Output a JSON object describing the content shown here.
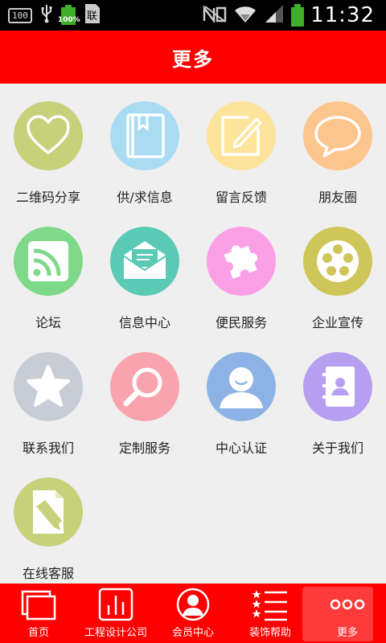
{
  "status_bar": {
    "badge": "100",
    "battery_small_pct": "100%",
    "time": "11:32"
  },
  "header": {
    "title": "更多"
  },
  "grid": {
    "items": [
      {
        "label": "二维码分享",
        "icon": "heart-icon",
        "color": "#c7d17a"
      },
      {
        "label": "供/求信息",
        "icon": "book-icon",
        "color": "#a9dcf3"
      },
      {
        "label": "留言反馈",
        "icon": "note-pencil-icon",
        "color": "#fde49b"
      },
      {
        "label": "朋友圈",
        "icon": "speech-bubble-icon",
        "color": "#fdc58e"
      },
      {
        "label": "论坛",
        "icon": "rss-icon",
        "color": "#7fd98a"
      },
      {
        "label": "信息中心",
        "icon": "envelope-icon",
        "color": "#5bcab5"
      },
      {
        "label": "便民服务",
        "icon": "puzzle-icon",
        "color": "#fba0e6"
      },
      {
        "label": "企业宣传",
        "icon": "film-reel-icon",
        "color": "#cfc65a"
      },
      {
        "label": "联系我们",
        "icon": "star-icon",
        "color": "#c7ccd6"
      },
      {
        "label": "定制服务",
        "icon": "magnifier-icon",
        "color": "#f8a3ad"
      },
      {
        "label": "中心认证",
        "icon": "user-icon",
        "color": "#8db3e6"
      },
      {
        "label": "关于我们",
        "icon": "contact-book-icon",
        "color": "#b69ff0"
      },
      {
        "label": "在线客服",
        "icon": "document-edit-icon",
        "color": "#c7d17a"
      }
    ]
  },
  "bottom_nav": {
    "items": [
      {
        "label": "首页",
        "icon": "home-pages-icon"
      },
      {
        "label": "工程设计公司",
        "icon": "chart-bars-icon"
      },
      {
        "label": "会员中心",
        "icon": "member-avatar-icon"
      },
      {
        "label": "装饰帮助",
        "icon": "star-list-icon"
      },
      {
        "label": "更多",
        "icon": "more-dots-icon",
        "active": true
      }
    ]
  }
}
